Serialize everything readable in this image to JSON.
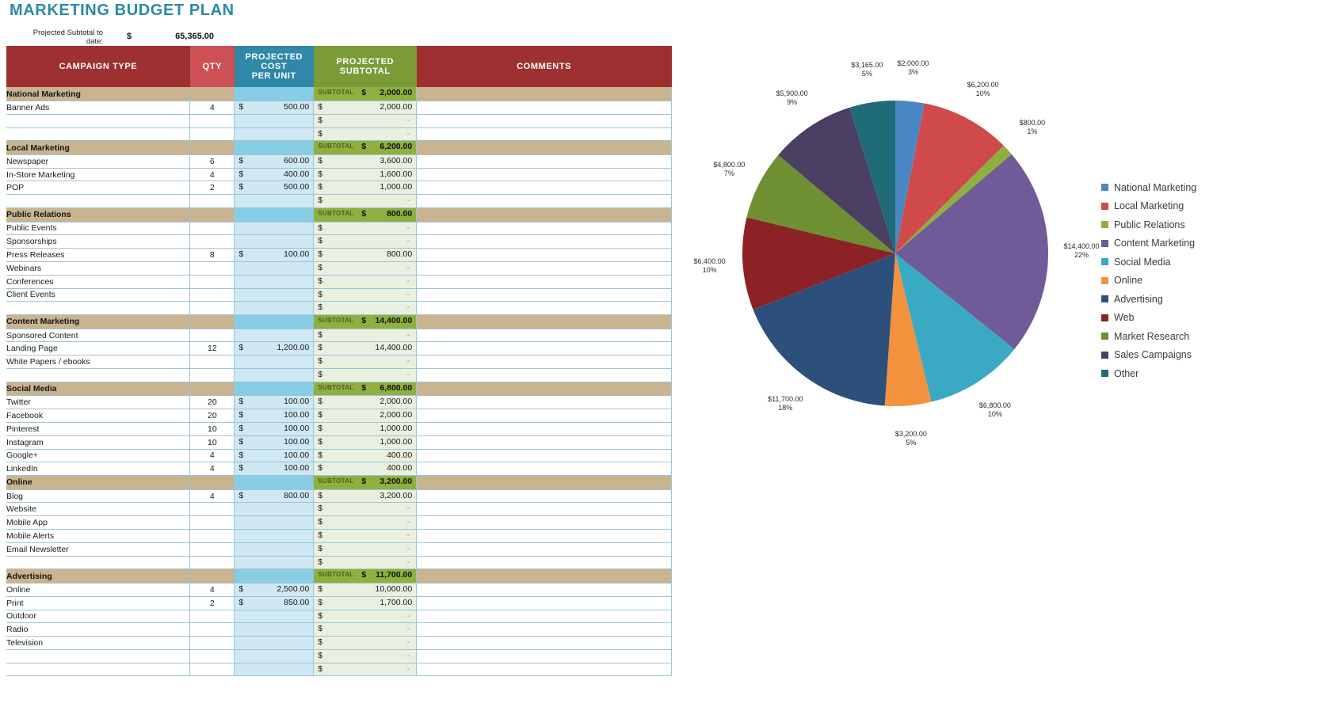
{
  "title": "MARKETING BUDGET PLAN",
  "summary": {
    "label": "Projected Subtotal to date:",
    "currency": "$",
    "value": "65,365.00"
  },
  "table": {
    "columns": [
      "CAMPAIGN TYPE",
      "QTY",
      "PROJECTED COST PER UNIT",
      "PROJECTED SUBTOTAL",
      "COMMENTS"
    ],
    "col_cost_line1": "PROJECTED COST",
    "col_cost_line2": "PER UNIT",
    "subtotal_word": "SUBTOTAL",
    "currency": "$",
    "dash": "-",
    "rows": [
      {
        "kind": "group",
        "name": "National Marketing",
        "subtotal": "2,000.00"
      },
      {
        "kind": "item",
        "name": "Banner Ads",
        "qty": "4",
        "cost": "500.00",
        "sub": "2,000.00"
      },
      {
        "kind": "item",
        "name": "",
        "qty": "",
        "cost": "",
        "sub": ""
      },
      {
        "kind": "item",
        "name": "",
        "qty": "",
        "cost": "",
        "sub": ""
      },
      {
        "kind": "group",
        "name": "Local Marketing",
        "subtotal": "6,200.00"
      },
      {
        "kind": "item",
        "name": "Newspaper",
        "qty": "6",
        "cost": "600.00",
        "sub": "3,600.00"
      },
      {
        "kind": "item",
        "name": "In-Store Marketing",
        "qty": "4",
        "cost": "400.00",
        "sub": "1,600.00"
      },
      {
        "kind": "item",
        "name": "POP",
        "qty": "2",
        "cost": "500.00",
        "sub": "1,000.00"
      },
      {
        "kind": "item",
        "name": "",
        "qty": "",
        "cost": "",
        "sub": ""
      },
      {
        "kind": "group",
        "name": "Public Relations",
        "subtotal": "800.00"
      },
      {
        "kind": "item",
        "name": "Public Events",
        "qty": "",
        "cost": "",
        "sub": ""
      },
      {
        "kind": "item",
        "name": "Sponsorships",
        "qty": "",
        "cost": "",
        "sub": ""
      },
      {
        "kind": "item",
        "name": "Press Releases",
        "qty": "8",
        "cost": "100.00",
        "sub": "800.00"
      },
      {
        "kind": "item",
        "name": "Webinars",
        "qty": "",
        "cost": "",
        "sub": ""
      },
      {
        "kind": "item",
        "name": "Conferences",
        "qty": "",
        "cost": "",
        "sub": ""
      },
      {
        "kind": "item",
        "name": "Client Events",
        "qty": "",
        "cost": "",
        "sub": ""
      },
      {
        "kind": "item",
        "name": "",
        "qty": "",
        "cost": "",
        "sub": ""
      },
      {
        "kind": "group",
        "name": "Content Marketing",
        "subtotal": "14,400.00"
      },
      {
        "kind": "item",
        "name": "Sponsored Content",
        "qty": "",
        "cost": "",
        "sub": ""
      },
      {
        "kind": "item",
        "name": "Landing Page",
        "qty": "12",
        "cost": "1,200.00",
        "sub": "14,400.00"
      },
      {
        "kind": "item",
        "name": "White Papers / ebooks",
        "qty": "",
        "cost": "",
        "sub": ""
      },
      {
        "kind": "item",
        "name": "",
        "qty": "",
        "cost": "",
        "sub": ""
      },
      {
        "kind": "group",
        "name": "Social Media",
        "subtotal": "6,800.00"
      },
      {
        "kind": "item",
        "name": "Twitter",
        "qty": "20",
        "cost": "100.00",
        "sub": "2,000.00"
      },
      {
        "kind": "item",
        "name": "Facebook",
        "qty": "20",
        "cost": "100.00",
        "sub": "2,000.00"
      },
      {
        "kind": "item",
        "name": "Pinterest",
        "qty": "10",
        "cost": "100.00",
        "sub": "1,000.00"
      },
      {
        "kind": "item",
        "name": "Instagram",
        "qty": "10",
        "cost": "100.00",
        "sub": "1,000.00"
      },
      {
        "kind": "item",
        "name": "Google+",
        "qty": "4",
        "cost": "100.00",
        "sub": "400.00"
      },
      {
        "kind": "item",
        "name": "LinkedIn",
        "qty": "4",
        "cost": "100.00",
        "sub": "400.00"
      },
      {
        "kind": "group",
        "name": "Online",
        "subtotal": "3,200.00"
      },
      {
        "kind": "item",
        "name": "Blog",
        "qty": "4",
        "cost": "800.00",
        "sub": "3,200.00"
      },
      {
        "kind": "item",
        "name": "Website",
        "qty": "",
        "cost": "",
        "sub": ""
      },
      {
        "kind": "item",
        "name": "Mobile App",
        "qty": "",
        "cost": "",
        "sub": ""
      },
      {
        "kind": "item",
        "name": "Mobile Alerts",
        "qty": "",
        "cost": "",
        "sub": ""
      },
      {
        "kind": "item",
        "name": "Email Newsletter",
        "qty": "",
        "cost": "",
        "sub": ""
      },
      {
        "kind": "item",
        "name": "",
        "qty": "",
        "cost": "",
        "sub": ""
      },
      {
        "kind": "group",
        "name": "Advertising",
        "subtotal": "11,700.00"
      },
      {
        "kind": "item",
        "name": "Online",
        "qty": "4",
        "cost": "2,500.00",
        "sub": "10,000.00"
      },
      {
        "kind": "item",
        "name": "Print",
        "qty": "2",
        "cost": "850.00",
        "sub": "1,700.00"
      },
      {
        "kind": "item",
        "name": "Outdoor",
        "qty": "",
        "cost": "",
        "sub": ""
      },
      {
        "kind": "item",
        "name": "Radio",
        "qty": "",
        "cost": "",
        "sub": ""
      },
      {
        "kind": "item",
        "name": "Television",
        "qty": "",
        "cost": "",
        "sub": ""
      },
      {
        "kind": "item",
        "name": "",
        "qty": "",
        "cost": "",
        "sub": ""
      },
      {
        "kind": "item",
        "name": "",
        "qty": "",
        "cost": "",
        "sub": ""
      }
    ]
  },
  "chart_data": {
    "type": "pie",
    "title": "",
    "legend_position": "right",
    "categories": [
      "National Marketing",
      "Local Marketing",
      "Public Relations",
      "Content Marketing",
      "Social Media",
      "Online",
      "Advertising",
      "Web",
      "Market Research",
      "Sales Campaigns",
      "Other"
    ],
    "values": [
      2000,
      6200,
      800,
      14400,
      6800,
      3200,
      11700,
      6400,
      4800,
      5900,
      3165
    ],
    "value_labels": [
      "$2,000.00",
      "$6,200.00",
      "$800.00",
      "$14,400.00",
      "$6,800.00",
      "$3,200.00",
      "$11,700.00",
      "$6,400.00",
      "$4,800.00",
      "$5,900.00",
      "$3,165.00"
    ],
    "percent_labels": [
      "3%",
      "10%",
      "1%",
      "22%",
      "10%",
      "5%",
      "18%",
      "10%",
      "7%",
      "9%",
      "5%"
    ],
    "colors": [
      "#4a87c4",
      "#cf4game",
      "#8fb03e",
      "#6f5b97",
      "#3aa9c4",
      "#f2923c",
      "#2c4f7c",
      "#8c2226",
      "#6f8f33",
      "#4b3f63",
      "#1f6b78"
    ]
  }
}
